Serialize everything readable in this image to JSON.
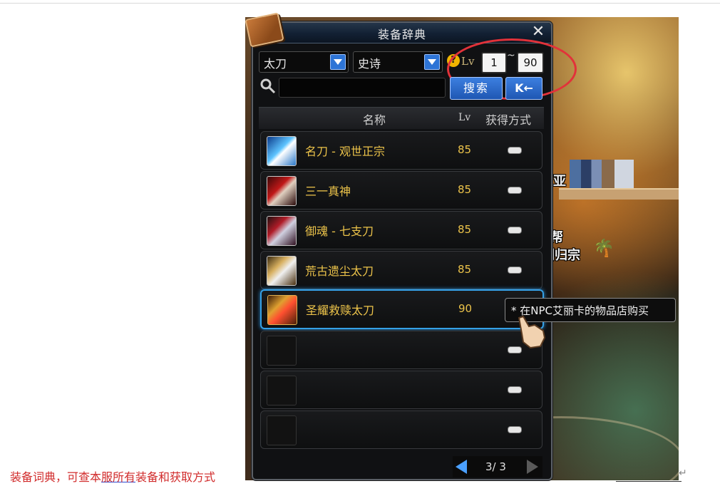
{
  "window": {
    "title": "装备辞典",
    "close_glyph": "✕"
  },
  "filters": {
    "weapon_type": "太刀",
    "rarity": "史诗",
    "help_glyph": "?",
    "level_label": "Lv",
    "level_min": "1",
    "level_sep": "~",
    "level_max": "90"
  },
  "search": {
    "placeholder": "",
    "button_label": "搜索",
    "first_page_glyph": "K←"
  },
  "table": {
    "headers": {
      "name": "名称",
      "lv": "Lv",
      "obtain": "获得方式"
    },
    "rows": [
      {
        "name": "名刀 - 观世正宗",
        "lv": "85",
        "icon": "katana-icon"
      },
      {
        "name": "三一真神",
        "lv": "85",
        "icon": "katana-icon"
      },
      {
        "name": "御魂 - 七支刀",
        "lv": "85",
        "icon": "katana-icon"
      },
      {
        "name": "荒古遗尘太刀",
        "lv": "85",
        "icon": "katana-icon"
      },
      {
        "name": "圣耀救赎太刀",
        "lv": "90",
        "icon": "katana-icon"
      }
    ]
  },
  "pagination": {
    "text": "3/ 3"
  },
  "tooltip": {
    "text": "* 在NPC艾丽卡的物品店购买"
  },
  "scene": {
    "label1": "赛丽亚",
    "label2": "炸天帮",
    "label3": "万剑归宗"
  },
  "caption": {
    "part1": "装备词典，可查本",
    "part2": "服所有",
    "part3": "装备和获取方式",
    "color": "#d12b2b"
  },
  "colors": {
    "gold_text": "#ecc34a",
    "accent_blue": "#35a0e6",
    "annotation_red": "#e2323a"
  }
}
